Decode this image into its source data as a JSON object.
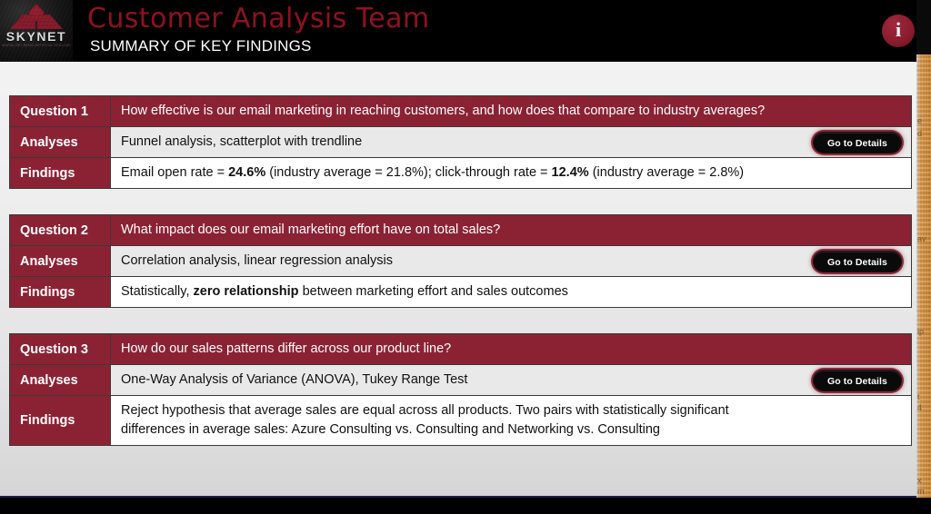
{
  "header": {
    "logo": {
      "wordmark": "SKYNET",
      "tagline": "NEURAL NET-BASED ARTIFICIAL INTELLIGENCE",
      "icon": "pyramid-logo"
    },
    "title": "Customer Analysis Team",
    "subtitle": "SUMMARY OF KEY FINDINGS",
    "info_button": {
      "glyph": "i",
      "icon": "info-icon"
    },
    "colors": {
      "background": "#000000",
      "title": "#8E1220",
      "subtitle": "#FFFFFF",
      "info_circle": "#8B1C2E"
    }
  },
  "labels": {
    "question": "Question",
    "analyses": "Analyses",
    "findings": "Findings",
    "details_button": "Go to Details"
  },
  "theme": {
    "accent_maroon": "#8B2234",
    "row_gray": "#E9E9E9",
    "row_white": "#FFFFFF",
    "border": "#3A3A3A",
    "slide_background": "#EFEFEF",
    "footer": "#000000",
    "rule": "#1F2340",
    "edge_panel": "#D28C39"
  },
  "blocks": [
    {
      "label": "Question 1",
      "question": "How effective is our email marketing in reaching customers, and how does that compare to industry averages?",
      "analyses_label": "Analyses",
      "analyses": "Funnel analysis, scatterplot with trendline",
      "findings_label": "Findings",
      "findings_lines": [
        "Email open rate = 24.6% (industry average = 21.8%); click-through rate = 12.4% (industry average = 2.8%)"
      ],
      "findings_bold": [
        "24.6%",
        "12.4%"
      ],
      "details_button": "Go to Details"
    },
    {
      "label": "Question 2",
      "question": "What impact does our email marketing effort have on total sales?",
      "analyses_label": "Analyses",
      "analyses": "Correlation analysis, linear regression analysis",
      "findings_label": "Findings",
      "findings_lines": [
        "Statistically, zero relationship between marketing effort and sales outcomes"
      ],
      "findings_bold": [
        "zero relationship"
      ],
      "details_button": "Go to Details"
    },
    {
      "label": "Question 3",
      "question": "How do our sales patterns differ across our product line?",
      "analyses_label": "Analyses",
      "analyses": "One-Way Analysis of Variance (ANOVA), Tukey Range Test",
      "findings_label": "Findings",
      "findings_lines": [
        "Reject hypothesis that average sales are equal across all products.  Two pairs with statistically significant",
        "differences in average sales:  Azure Consulting vs. Consulting and Networking vs. Consulting"
      ],
      "findings_bold": [],
      "details_button": "Go to Details"
    }
  ],
  "edge_panel": {
    "fragments": [
      "e",
      "d",
      "av",
      "ip",
      "t",
      "4",
      "x",
      "m"
    ]
  }
}
